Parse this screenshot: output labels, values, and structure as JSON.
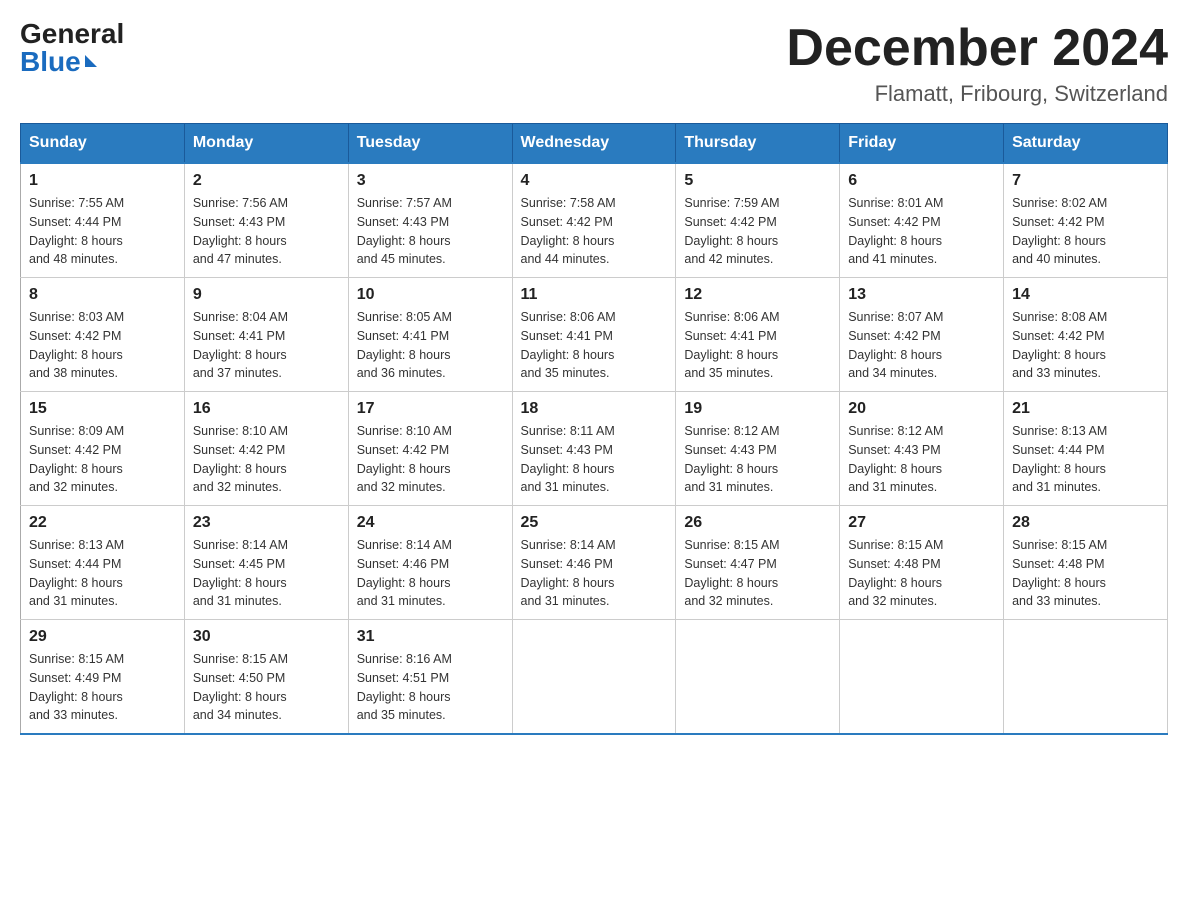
{
  "header": {
    "logo_general": "General",
    "logo_blue": "Blue",
    "main_title": "December 2024",
    "subtitle": "Flamatt, Fribourg, Switzerland"
  },
  "days_of_week": [
    "Sunday",
    "Monday",
    "Tuesday",
    "Wednesday",
    "Thursday",
    "Friday",
    "Saturday"
  ],
  "weeks": [
    [
      {
        "day": "1",
        "sunrise": "7:55 AM",
        "sunset": "4:44 PM",
        "daylight": "8 hours and 48 minutes."
      },
      {
        "day": "2",
        "sunrise": "7:56 AM",
        "sunset": "4:43 PM",
        "daylight": "8 hours and 47 minutes."
      },
      {
        "day": "3",
        "sunrise": "7:57 AM",
        "sunset": "4:43 PM",
        "daylight": "8 hours and 45 minutes."
      },
      {
        "day": "4",
        "sunrise": "7:58 AM",
        "sunset": "4:42 PM",
        "daylight": "8 hours and 44 minutes."
      },
      {
        "day": "5",
        "sunrise": "7:59 AM",
        "sunset": "4:42 PM",
        "daylight": "8 hours and 42 minutes."
      },
      {
        "day": "6",
        "sunrise": "8:01 AM",
        "sunset": "4:42 PM",
        "daylight": "8 hours and 41 minutes."
      },
      {
        "day": "7",
        "sunrise": "8:02 AM",
        "sunset": "4:42 PM",
        "daylight": "8 hours and 40 minutes."
      }
    ],
    [
      {
        "day": "8",
        "sunrise": "8:03 AM",
        "sunset": "4:42 PM",
        "daylight": "8 hours and 38 minutes."
      },
      {
        "day": "9",
        "sunrise": "8:04 AM",
        "sunset": "4:41 PM",
        "daylight": "8 hours and 37 minutes."
      },
      {
        "day": "10",
        "sunrise": "8:05 AM",
        "sunset": "4:41 PM",
        "daylight": "8 hours and 36 minutes."
      },
      {
        "day": "11",
        "sunrise": "8:06 AM",
        "sunset": "4:41 PM",
        "daylight": "8 hours and 35 minutes."
      },
      {
        "day": "12",
        "sunrise": "8:06 AM",
        "sunset": "4:41 PM",
        "daylight": "8 hours and 35 minutes."
      },
      {
        "day": "13",
        "sunrise": "8:07 AM",
        "sunset": "4:42 PM",
        "daylight": "8 hours and 34 minutes."
      },
      {
        "day": "14",
        "sunrise": "8:08 AM",
        "sunset": "4:42 PM",
        "daylight": "8 hours and 33 minutes."
      }
    ],
    [
      {
        "day": "15",
        "sunrise": "8:09 AM",
        "sunset": "4:42 PM",
        "daylight": "8 hours and 32 minutes."
      },
      {
        "day": "16",
        "sunrise": "8:10 AM",
        "sunset": "4:42 PM",
        "daylight": "8 hours and 32 minutes."
      },
      {
        "day": "17",
        "sunrise": "8:10 AM",
        "sunset": "4:42 PM",
        "daylight": "8 hours and 32 minutes."
      },
      {
        "day": "18",
        "sunrise": "8:11 AM",
        "sunset": "4:43 PM",
        "daylight": "8 hours and 31 minutes."
      },
      {
        "day": "19",
        "sunrise": "8:12 AM",
        "sunset": "4:43 PM",
        "daylight": "8 hours and 31 minutes."
      },
      {
        "day": "20",
        "sunrise": "8:12 AM",
        "sunset": "4:43 PM",
        "daylight": "8 hours and 31 minutes."
      },
      {
        "day": "21",
        "sunrise": "8:13 AM",
        "sunset": "4:44 PM",
        "daylight": "8 hours and 31 minutes."
      }
    ],
    [
      {
        "day": "22",
        "sunrise": "8:13 AM",
        "sunset": "4:44 PM",
        "daylight": "8 hours and 31 minutes."
      },
      {
        "day": "23",
        "sunrise": "8:14 AM",
        "sunset": "4:45 PM",
        "daylight": "8 hours and 31 minutes."
      },
      {
        "day": "24",
        "sunrise": "8:14 AM",
        "sunset": "4:46 PM",
        "daylight": "8 hours and 31 minutes."
      },
      {
        "day": "25",
        "sunrise": "8:14 AM",
        "sunset": "4:46 PM",
        "daylight": "8 hours and 31 minutes."
      },
      {
        "day": "26",
        "sunrise": "8:15 AM",
        "sunset": "4:47 PM",
        "daylight": "8 hours and 32 minutes."
      },
      {
        "day": "27",
        "sunrise": "8:15 AM",
        "sunset": "4:48 PM",
        "daylight": "8 hours and 32 minutes."
      },
      {
        "day": "28",
        "sunrise": "8:15 AM",
        "sunset": "4:48 PM",
        "daylight": "8 hours and 33 minutes."
      }
    ],
    [
      {
        "day": "29",
        "sunrise": "8:15 AM",
        "sunset": "4:49 PM",
        "daylight": "8 hours and 33 minutes."
      },
      {
        "day": "30",
        "sunrise": "8:15 AM",
        "sunset": "4:50 PM",
        "daylight": "8 hours and 34 minutes."
      },
      {
        "day": "31",
        "sunrise": "8:16 AM",
        "sunset": "4:51 PM",
        "daylight": "8 hours and 35 minutes."
      },
      null,
      null,
      null,
      null
    ]
  ],
  "labels": {
    "sunrise": "Sunrise:",
    "sunset": "Sunset:",
    "daylight": "Daylight:"
  }
}
